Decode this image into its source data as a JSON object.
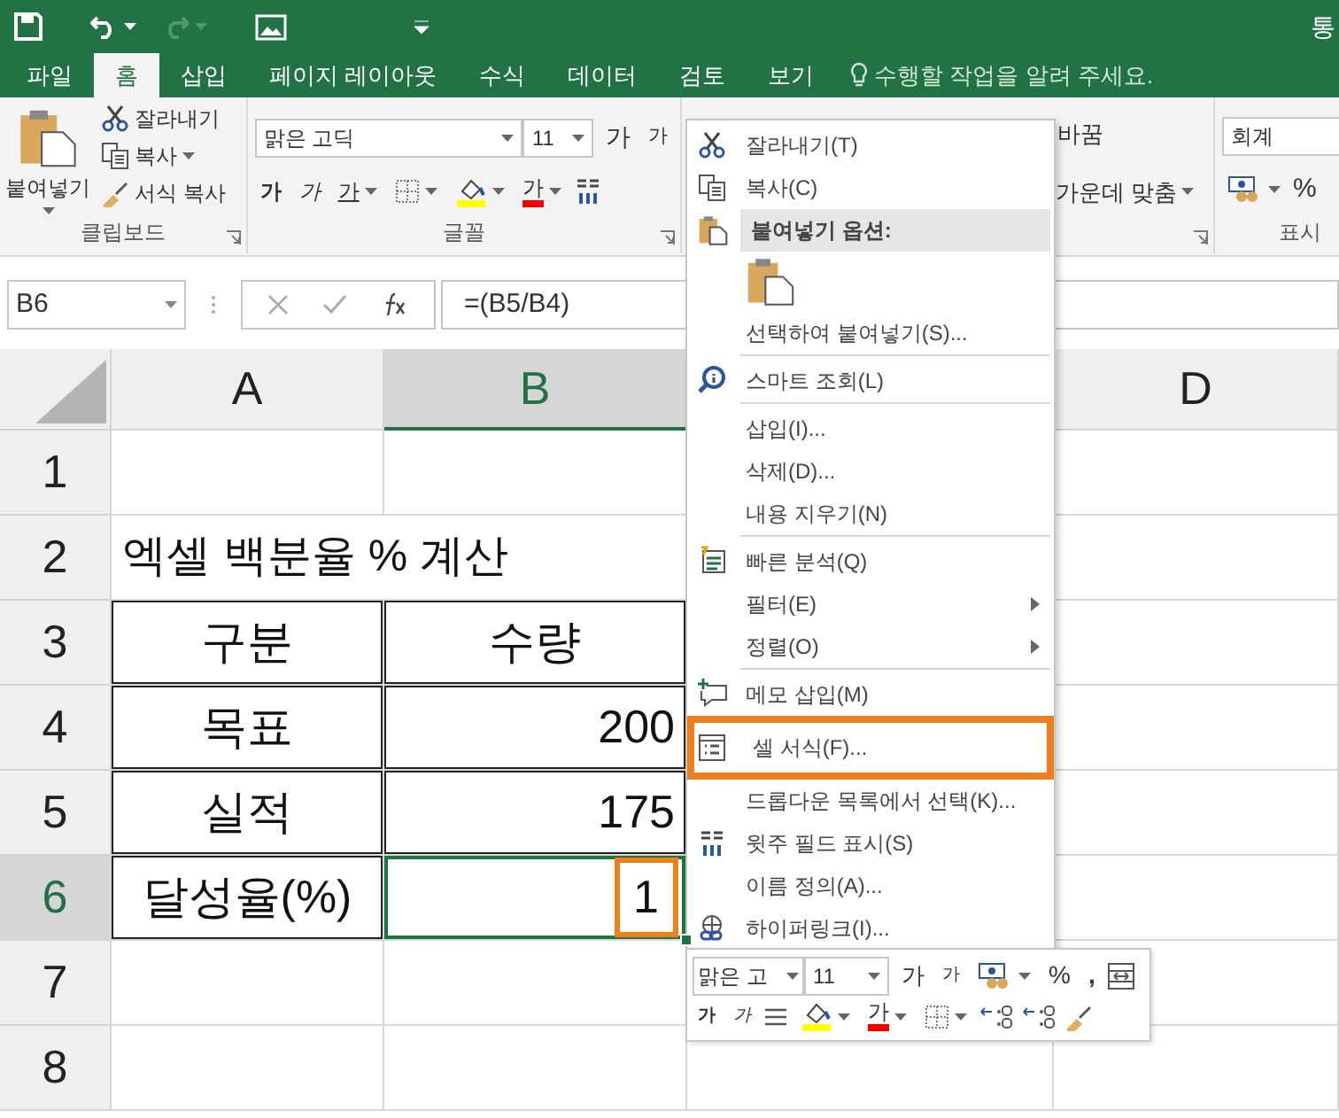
{
  "quick_access": {
    "redo_disabled": true
  },
  "window": {
    "title": "통"
  },
  "tabs": [
    {
      "label": "파일",
      "selected": false
    },
    {
      "label": "홈",
      "selected": true
    },
    {
      "label": "삽입",
      "selected": false
    },
    {
      "label": "페이지 레이아웃",
      "selected": false
    },
    {
      "label": "수식",
      "selected": false
    },
    {
      "label": "데이터",
      "selected": false
    },
    {
      "label": "검토",
      "selected": false
    },
    {
      "label": "보기",
      "selected": false
    }
  ],
  "tell_me": {
    "placeholder": "수행할 작업을 알려 주세요."
  },
  "ribbon": {
    "clipboard": {
      "paste": "붙여넣기",
      "cut": "잘라내기",
      "copy": "복사",
      "format_painter": "서식 복사",
      "label": "클립보드"
    },
    "font": {
      "font_name": "맑은 고딕",
      "font_size": "11",
      "grow": "가",
      "shrink": "가",
      "bold": "가",
      "italic": "가",
      "underline": "가",
      "font_color": "가",
      "label": "글꼴"
    },
    "alignment": {
      "wrap_text": "바꿈",
      "merge_center": "가운데 맞춤"
    },
    "number": {
      "format": "회계",
      "percent": "%",
      "label": "표시"
    }
  },
  "formula_bar": {
    "name_box": "B6",
    "formula": "=(B5/B4)"
  },
  "sheet": {
    "columns": [
      {
        "label": "A",
        "selected": false
      },
      {
        "label": "B",
        "selected": true
      },
      {
        "label": "D",
        "selected": false
      }
    ],
    "rows": [
      {
        "number": "1",
        "selected": false
      },
      {
        "number": "2",
        "selected": false,
        "cells": [
          {
            "text": "엑셀 백분율 % 계산",
            "kind": "title",
            "bordered": false,
            "active": false,
            "highlight": false
          }
        ]
      },
      {
        "number": "3",
        "selected": false,
        "cells": [
          {
            "text": "구분",
            "kind": "text",
            "bordered": true,
            "active": false,
            "highlight": false
          },
          {
            "text": "수량",
            "kind": "text",
            "bordered": true,
            "active": false,
            "highlight": false
          }
        ]
      },
      {
        "number": "4",
        "selected": false,
        "cells": [
          {
            "text": "목표",
            "kind": "text",
            "bordered": true,
            "active": false,
            "highlight": false
          },
          {
            "text": "200",
            "kind": "number",
            "bordered": true,
            "active": false,
            "highlight": false
          }
        ]
      },
      {
        "number": "5",
        "selected": false,
        "cells": [
          {
            "text": "실적",
            "kind": "text",
            "bordered": true,
            "active": false,
            "highlight": false
          },
          {
            "text": "175",
            "kind": "number",
            "bordered": true,
            "active": false,
            "highlight": false
          }
        ]
      },
      {
        "number": "6",
        "selected": true,
        "cells": [
          {
            "text": "달성율(%)",
            "kind": "text",
            "bordered": true,
            "active": false,
            "highlight": false
          },
          {
            "text": "1",
            "kind": "number",
            "bordered": true,
            "active": true,
            "highlight": true
          }
        ]
      },
      {
        "number": "7",
        "selected": false
      },
      {
        "number": "8",
        "selected": false
      }
    ]
  },
  "context_menu": {
    "items": [
      {
        "kind": "item",
        "label": "잘라내기(T)",
        "submenu": false,
        "separator_before": false,
        "highlight": false
      },
      {
        "kind": "item",
        "label": "복사(C)",
        "submenu": false,
        "separator_before": false,
        "highlight": false
      },
      {
        "kind": "header",
        "label": "붙여넣기 옵션:",
        "submenu": false,
        "separator_before": false,
        "highlight": false
      },
      {
        "kind": "paste-option",
        "submenu": false,
        "separator_before": false,
        "highlight": false
      },
      {
        "kind": "item",
        "label": "선택하여 붙여넣기(S)...",
        "submenu": false,
        "separator_before": false,
        "highlight": false
      },
      {
        "kind": "item",
        "label": "스마트 조회(L)",
        "submenu": false,
        "separator_before": true,
        "highlight": false
      },
      {
        "kind": "item",
        "label": "삽입(I)...",
        "submenu": false,
        "separator_before": true,
        "highlight": false
      },
      {
        "kind": "item",
        "label": "삭제(D)...",
        "submenu": false,
        "separator_before": false,
        "highlight": false
      },
      {
        "kind": "item",
        "label": "내용 지우기(N)",
        "submenu": false,
        "separator_before": false,
        "highlight": false
      },
      {
        "kind": "item",
        "label": "빠른 분석(Q)",
        "submenu": false,
        "separator_before": true,
        "highlight": false
      },
      {
        "kind": "item",
        "label": "필터(E)",
        "submenu": true,
        "separator_before": false,
        "highlight": false
      },
      {
        "kind": "item",
        "label": "정렬(O)",
        "submenu": true,
        "separator_before": false,
        "highlight": false
      },
      {
        "kind": "item",
        "label": "메모 삽입(M)",
        "submenu": false,
        "separator_before": true,
        "highlight": false
      },
      {
        "kind": "item",
        "label": "셀 서식(F)...",
        "submenu": false,
        "separator_before": false,
        "highlight": true
      },
      {
        "kind": "item",
        "label": "드롭다운 목록에서 선택(K)...",
        "submenu": false,
        "separator_before": false,
        "highlight": false
      },
      {
        "kind": "item",
        "label": "윗주 필드 표시(S)",
        "submenu": false,
        "separator_before": false,
        "highlight": false
      },
      {
        "kind": "item",
        "label": "이름 정의(A)...",
        "submenu": false,
        "separator_before": false,
        "highlight": false
      },
      {
        "kind": "item",
        "label": "하이퍼링크(I)...",
        "submenu": false,
        "separator_before": false,
        "highlight": false
      }
    ]
  },
  "mini_toolbar": {
    "font_name": "맑은 고",
    "font_size": "11",
    "grow": "가",
    "shrink": "가",
    "percent": "%",
    "comma": ",",
    "bold": "가",
    "italic": "가",
    "font_color": "가"
  }
}
